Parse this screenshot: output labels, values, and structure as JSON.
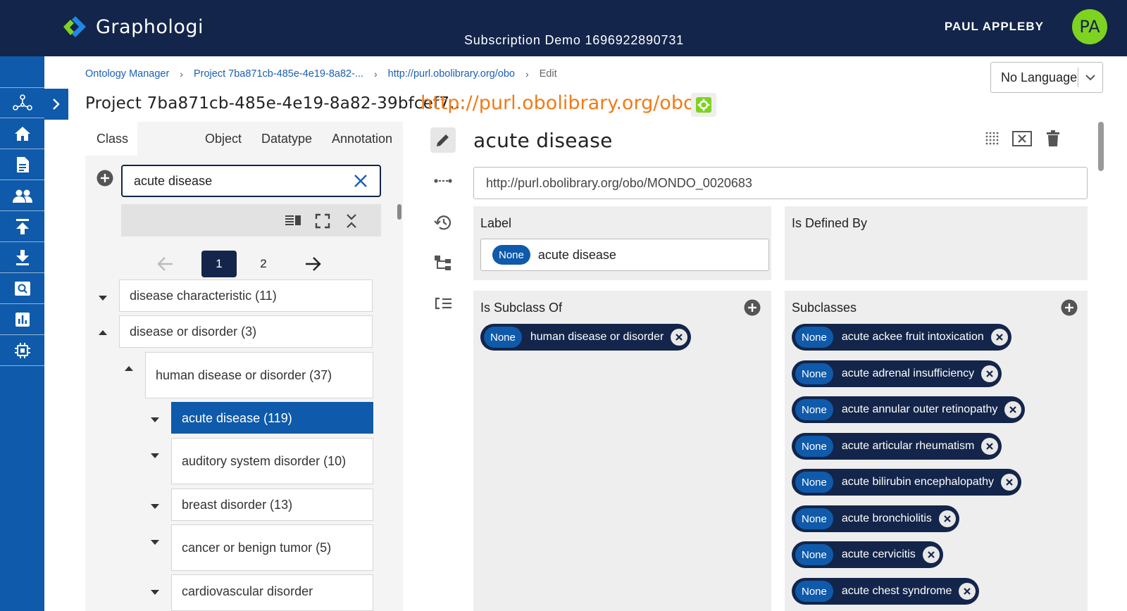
{
  "app": {
    "brand": "Graphologi",
    "subscription": "Subscription Demo 1696922890731",
    "user_name": "PAUL APPLEBY",
    "avatar_initials": "PA",
    "accent_color": "#0f5aaa",
    "header_color": "#13254a"
  },
  "rail": {
    "items": [
      "graph-icon",
      "home-icon",
      "document-icon",
      "people-icon",
      "upload-icon",
      "download-icon",
      "search-icon",
      "chart-icon",
      "chip-icon"
    ]
  },
  "breadcrumb": {
    "items": [
      "Ontology Manager",
      "Project 7ba871cb-485e-4e19-8a82-...",
      "http://purl.obolibrary.org/obo"
    ],
    "current": "Edit"
  },
  "language": {
    "selected": "No Language"
  },
  "project": {
    "title": "Project 7ba871cb-485e-4e19-8a82-39bfcef7...",
    "ontology_iri": "http://purl.obolibrary.org/obo"
  },
  "left": {
    "tabs": [
      "Class",
      "Object",
      "Datatype",
      "Annotation"
    ],
    "search_value": "acute disease",
    "pager": {
      "pages": [
        "1",
        "2"
      ],
      "current_page": "1"
    },
    "tree": [
      {
        "label": "disease characteristic (11)",
        "expanded": false
      },
      {
        "label": "disease or disorder (3)",
        "expanded": true
      },
      {
        "label": "human disease or disorder (37)",
        "expanded": true
      },
      {
        "label": "acute disease (119)",
        "selected": true
      },
      {
        "label": "auditory system disorder (10)"
      },
      {
        "label": "breast disorder (13)"
      },
      {
        "label": "cancer or benign tumor (5)"
      },
      {
        "label": "cardiovascular disorder"
      }
    ]
  },
  "detail": {
    "title": "acute disease",
    "iri": "http://purl.obolibrary.org/obo/MONDO_0020683",
    "label_card": {
      "title": "Label",
      "language": "None",
      "value": "acute disease"
    },
    "defined_by_card": {
      "title": "Is Defined By"
    },
    "subclass_of_card": {
      "title": "Is Subclass Of",
      "items": [
        {
          "language": "None",
          "label": "human disease or disorder"
        }
      ]
    },
    "subclasses_card": {
      "title": "Subclasses",
      "items": [
        {
          "language": "None",
          "label": "acute ackee fruit intoxication"
        },
        {
          "language": "None",
          "label": "acute adrenal insufficiency"
        },
        {
          "language": "None",
          "label": "acute annular outer retinopathy"
        },
        {
          "language": "None",
          "label": "acute articular rheumatism"
        },
        {
          "language": "None",
          "label": "acute bilirubin encephalopathy"
        },
        {
          "language": "None",
          "label": "acute bronchiolitis"
        },
        {
          "language": "None",
          "label": "acute cervicitis"
        },
        {
          "language": "None",
          "label": "acute chest syndrome"
        }
      ]
    }
  }
}
